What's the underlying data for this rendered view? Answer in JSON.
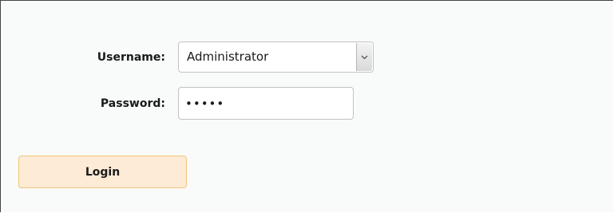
{
  "login_form": {
    "username_label": "Username:",
    "username_value": "Administrator",
    "password_label": "Password:",
    "password_value": "•••••",
    "login_label": "Login"
  },
  "icons": {
    "dropdown": "chevron-down-icon"
  }
}
